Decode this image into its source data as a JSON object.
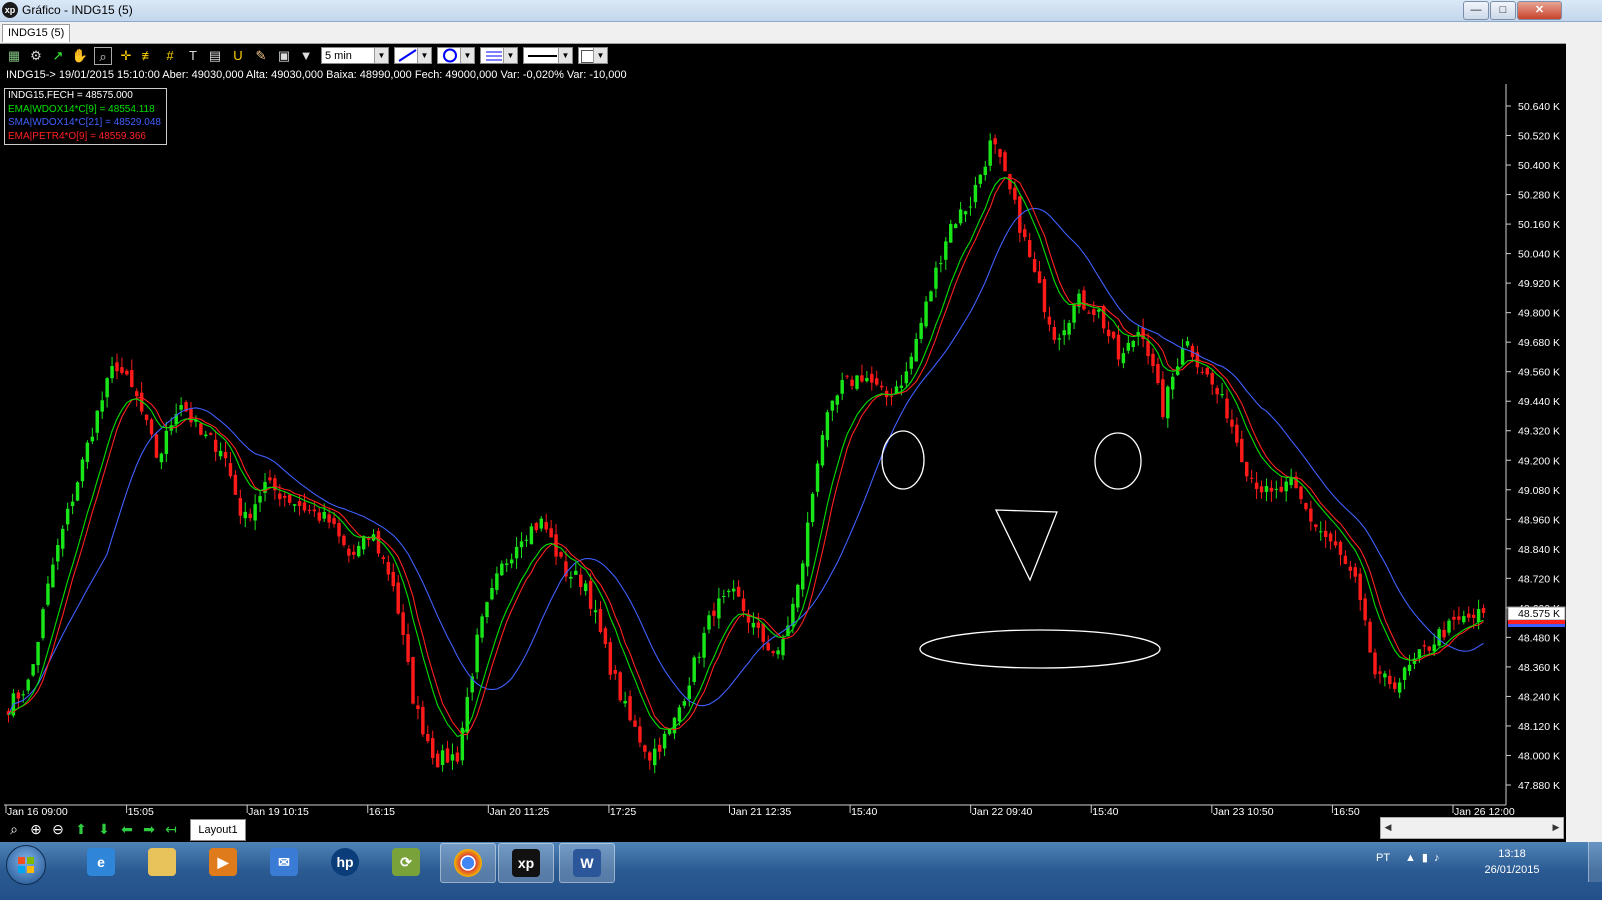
{
  "window": {
    "title": "Gráfico - INDG15 (5)",
    "app_logo": "xp",
    "controls": {
      "minimize": "—",
      "maximize": "□",
      "close": "✕"
    }
  },
  "tabs": [
    "INDG15 (5)"
  ],
  "toolbar": {
    "interval": "5 min",
    "icons": [
      "chart-icon",
      "gear-icon",
      "trend-icon",
      "hand-icon",
      "zoom-cursor-icon",
      "crosshair-icon",
      "fibonacci-icon",
      "grid-icon",
      "text-icon",
      "calculator-icon",
      "magnet-icon",
      "eraser-icon",
      "clipboard-icon",
      "filter-icon",
      "line-tool-icon",
      "ellipse-tool-icon",
      "line-style-icon",
      "line-width-icon",
      "color-box-icon"
    ]
  },
  "info_line": "INDG15-> 19/01/2015 15:10:00 Aber: 49030,000 Alta: 49030,000 Baixa: 48990,000 Fech: 49000,000 Var: -0,020% Var: -10,000",
  "legend": [
    {
      "text": "INDG15.FECH = 48575.000",
      "color": "#ffffff"
    },
    {
      "text": "EMA|WDOX14*C[9] = 48554.118",
      "color": "#00e000"
    },
    {
      "text": "SMA|WDOX14*C[21] = 48529.048",
      "color": "#3f5fff"
    },
    {
      "text": "EMA|PETR4*O[9] = 48559.366",
      "color": "#ff2020"
    }
  ],
  "chart_data": {
    "type": "candlestick",
    "series_names": [
      "INDG15.FECH",
      "EMA|WDOX14*C[9]",
      "SMA|WDOX14*C[21]",
      "EMA|PETR4*O[9]"
    ],
    "y_ticks": [
      "50.640 K",
      "50.520 K",
      "50.400 K",
      "50.280 K",
      "50.160 K",
      "50.040 K",
      "49.920 K",
      "49.800 K",
      "49.680 K",
      "49.560 K",
      "49.440 K",
      "49.320 K",
      "49.200 K",
      "49.080 K",
      "48.960 K",
      "48.840 K",
      "48.720 K",
      "48.600 K",
      "48.480 K",
      "48.360 K",
      "48.240 K",
      "48.120 K",
      "48.000 K",
      "47.880 K"
    ],
    "y_tick_values": [
      50640,
      50520,
      50400,
      50280,
      50160,
      50040,
      49920,
      49800,
      49680,
      49560,
      49440,
      49320,
      49200,
      49080,
      48960,
      48840,
      48720,
      48600,
      48480,
      48360,
      48240,
      48120,
      48000,
      47880
    ],
    "ylim": [
      47840,
      50720
    ],
    "current_price_label": "48.575 K",
    "current_price": 48575,
    "x_ticks": [
      "Jan 16 09:00",
      "15:05",
      "Jan 19 10:15",
      "16:15",
      "Jan 20 11:25",
      "17:25",
      "Jan 21 12:35",
      "15:40",
      "Jan 22 09:40",
      "15:40",
      "Jan 23 10:50",
      "16:50",
      "Jan 26 12:00"
    ],
    "anchor_closes": [
      48200,
      48300,
      48750,
      49050,
      49350,
      49600,
      49450,
      49200,
      49450,
      49300,
      49250,
      48950,
      49100,
      49050,
      49000,
      48950,
      48800,
      48900,
      48700,
      48200,
      47980,
      48000,
      48500,
      48750,
      48900,
      48950,
      48750,
      48700,
      48400,
      48150,
      48000,
      48100,
      48350,
      48600,
      48650,
      48500,
      48400,
      48700,
      49300,
      49500,
      49550,
      49450,
      49550,
      49850,
      50150,
      50250,
      50500,
      50250,
      49950,
      49700,
      49850,
      49800,
      49600,
      49750,
      49400,
      49700,
      49550,
      49400,
      49150,
      49050,
      49100,
      48950,
      48850,
      48700,
      48300,
      48300,
      48400,
      48500,
      48550,
      48575
    ]
  },
  "bottom_nav": {
    "layout_tab": "Layout1",
    "icons": [
      "zoom-icon",
      "zoom-in-icon",
      "zoom-out-icon",
      "arrow-up-icon",
      "arrow-down-icon",
      "arrow-left-icon",
      "arrow-right-icon",
      "arrow-return-icon"
    ]
  },
  "taskbar": {
    "apps": [
      "ie-icon",
      "folder-icon",
      "media-player-icon",
      "mail-icon",
      "hp-icon",
      "sync-icon",
      "chrome-icon",
      "xp-app-icon",
      "word-icon"
    ],
    "language": "PT",
    "time": "13:18",
    "date": "26/01/2015"
  },
  "colors": {
    "up": "#19e619",
    "down": "#ff1a1a",
    "ema9": "#00e000",
    "sma21": "#3f5fff",
    "ema_petr": "#ff2020"
  }
}
